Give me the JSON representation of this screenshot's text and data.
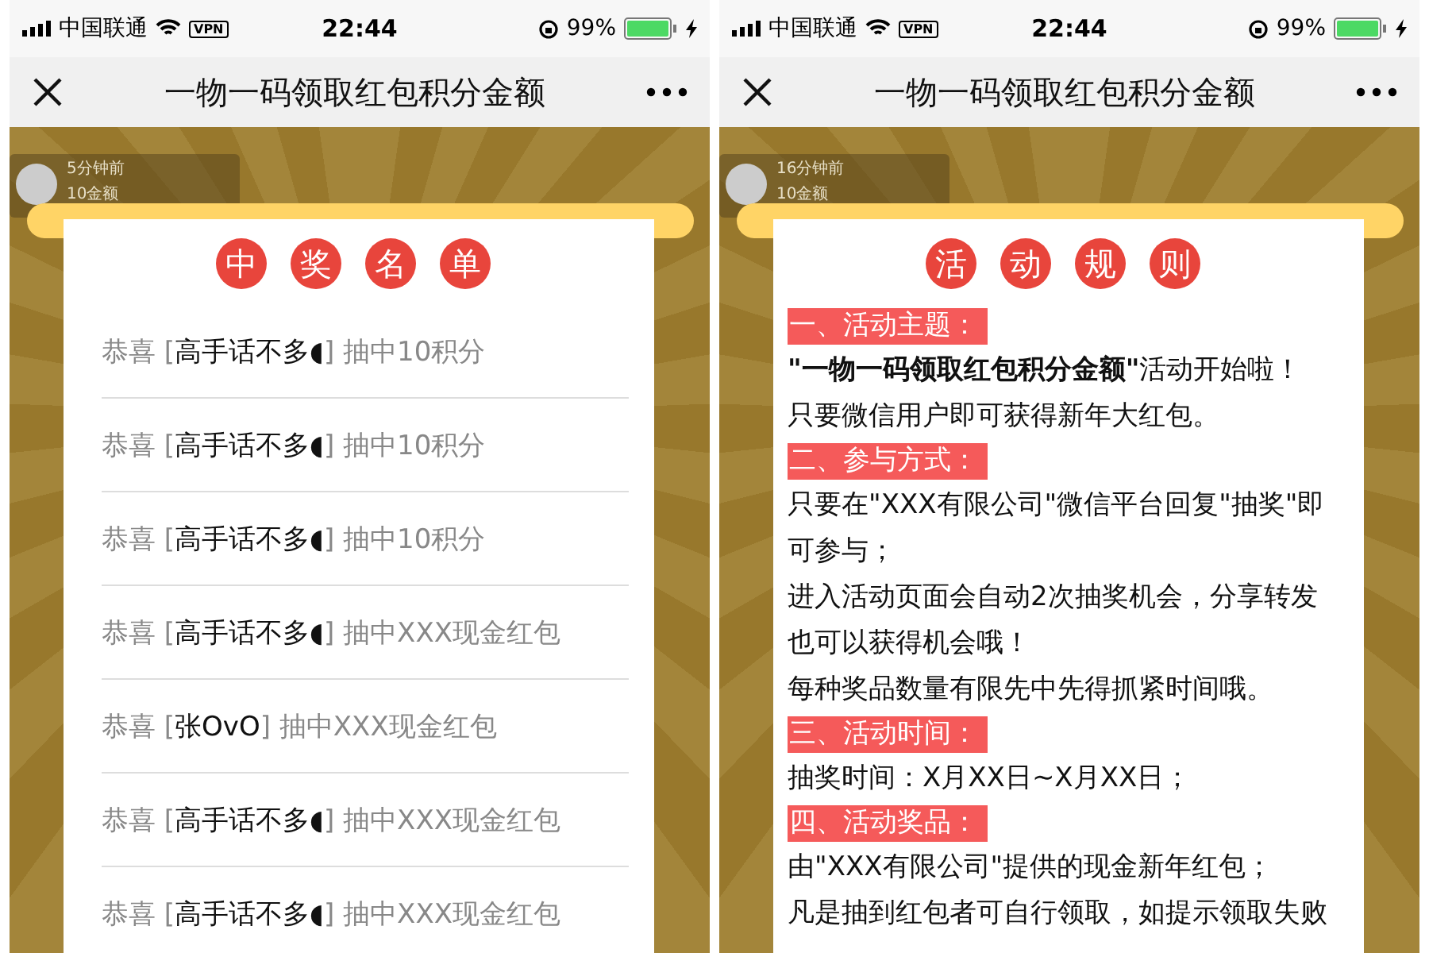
{
  "screens": [
    {
      "status_bar": {
        "carrier": "中国联通",
        "vpn": "VPN",
        "time": "22:44",
        "battery": "99%"
      },
      "nav": {
        "title": "一物一码领取红包积分金额"
      },
      "ticker": {
        "time": "5分钟前",
        "amount": "10金额"
      },
      "card": {
        "kind": "winners",
        "title_chars": [
          "中",
          "奖",
          "名",
          "单"
        ],
        "winners": [
          {
            "lead": "恭喜 [",
            "name": "高手话不多◖",
            "tail": "] 抽中10积分"
          },
          {
            "lead": "恭喜 [",
            "name": "高手话不多◖",
            "tail": "] 抽中10积分"
          },
          {
            "lead": "恭喜 [",
            "name": "高手话不多◖",
            "tail": "] 抽中10积分"
          },
          {
            "lead": "恭喜 [",
            "name": "高手话不多◖",
            "tail": "] 抽中XXX现金红包"
          },
          {
            "lead": "恭喜 [",
            "name": "张OvO",
            "tail": "] 抽中XXX现金红包"
          },
          {
            "lead": "恭喜 [",
            "name": "高手话不多◖",
            "tail": "] 抽中XXX现金红包"
          },
          {
            "lead": "恭喜 [",
            "name": "高手话不多◖",
            "tail": "] 抽中XXX现金红包"
          }
        ]
      }
    },
    {
      "status_bar": {
        "carrier": "中国联通",
        "vpn": "VPN",
        "time": "22:44",
        "battery": "99%"
      },
      "nav": {
        "title": "一物一码领取红包积分金额"
      },
      "ticker": {
        "time": "16分钟前",
        "amount": "10金额"
      },
      "card": {
        "kind": "rules",
        "title_chars": [
          "活",
          "动",
          "规",
          "则"
        ],
        "sections": [
          {
            "heading": "一、活动主题：",
            "lines": [
              "**\"一物一码领取红包积分金额\"**活动开始啦！",
              "只要微信用户即可获得新年大红包。"
            ]
          },
          {
            "heading": "二、参与方式：",
            "lines": [
              "只要在\"XXX有限公司\"微信平台回复\"抽奖\"即可参与；",
              "进入活动页面会自动2次抽奖机会，分享转发也可以获得机会哦！",
              "每种奖品数量有限先中先得抓紧时间哦。"
            ]
          },
          {
            "heading": "三、活动时间：",
            "lines": [
              "抽奖时间：X月XX日~X月XX日；"
            ]
          },
          {
            "heading": "四、活动奖品：",
            "lines": [
              "由\"XXX有限公司\"提供的现金新年红包；",
              "凡是抽到红包者可自行领取，如提示领取失败"
            ]
          }
        ]
      }
    }
  ]
}
